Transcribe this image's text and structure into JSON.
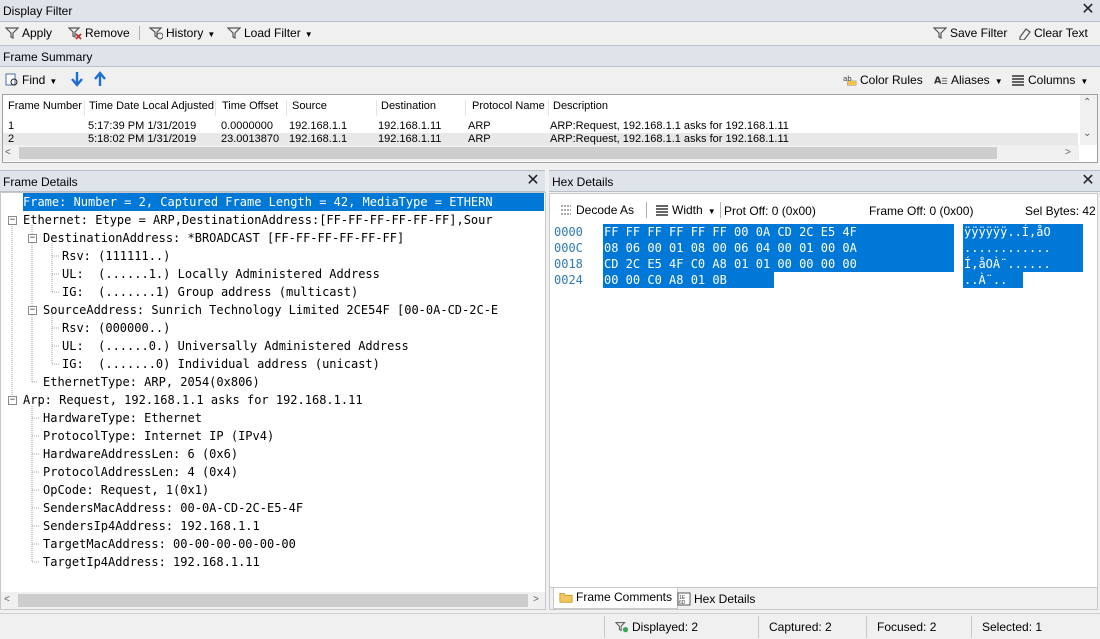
{
  "display_filter": {
    "title": "Display Filter",
    "apply": "Apply",
    "remove": "Remove",
    "history": "History",
    "load_filter": "Load Filter",
    "save_filter": "Save Filter",
    "clear_text": "Clear Text"
  },
  "frame_summary": {
    "title": "Frame Summary",
    "find": "Find",
    "color_rules": "Color Rules",
    "aliases": "Aliases",
    "columns": "Columns",
    "headers": [
      "Frame Number",
      "Time Date Local Adjusted",
      "Time Offset",
      "Source",
      "Destination",
      "Protocol Name",
      "Description"
    ],
    "rows": [
      [
        "1",
        "5:17:39 PM 1/31/2019",
        "0.0000000",
        "192.168.1.1",
        "192.168.1.11",
        "ARP",
        "ARP:Request, 192.168.1.1 asks for 192.168.1.11"
      ],
      [
        "2",
        "5:18:02 PM 1/31/2019",
        "23.0013870",
        "192.168.1.1",
        "192.168.1.11",
        "ARP",
        "ARP:Request, 192.168.1.1 asks for 192.168.1.11"
      ]
    ]
  },
  "frame_details": {
    "title": "Frame Details",
    "lines": [
      "Frame: Number = 2, Captured Frame Length = 42, MediaType = ETHERN",
      "Ethernet: Etype = ARP,DestinationAddress:[FF-FF-FF-FF-FF-FF],Sour",
      "DestinationAddress: *BROADCAST [FF-FF-FF-FF-FF-FF]",
      "Rsv: (111111..)",
      "UL:  (......1.) Locally Administered Address",
      "IG:  (.......1) Group address (multicast)",
      "SourceAddress: Sunrich Technology Limited 2CE54F [00-0A-CD-2C-E",
      "Rsv: (000000..)",
      "UL:  (......0.) Universally Administered Address",
      "IG:  (.......0) Individual address (unicast)",
      "EthernetType: ARP, 2054(0x806)",
      "Arp: Request, 192.168.1.1 asks for 192.168.1.11",
      "HardwareType: Ethernet",
      "ProtocolType: Internet IP (IPv4)",
      "HardwareAddressLen: 6 (0x6)",
      "ProtocolAddressLen: 4 (0x4)",
      "OpCode: Request, 1(0x1)",
      "SendersMacAddress: 00-0A-CD-2C-E5-4F",
      "SendersIp4Address: 192.168.1.1",
      "TargetMacAddress: 00-00-00-00-00-00",
      "TargetIp4Address: 192.168.1.11"
    ]
  },
  "hex_details": {
    "title": "Hex Details",
    "decode_as": "Decode As",
    "width": "Width",
    "prot_off": "Prot Off: 0 (0x00)",
    "frame_off": "Frame Off: 0 (0x00)",
    "sel_bytes": "Sel Bytes: 42",
    "offsets": [
      "0000",
      "000C",
      "0018",
      "0024"
    ],
    "hex_rows": [
      "FF FF FF FF FF FF 00 0A CD 2C E5 4F",
      "08 06 00 01 08 00 06 04 00 01 00 0A",
      "CD 2C E5 4F C0 A8 01 01 00 00 00 00",
      "00 00 C0 A8 01 0B"
    ],
    "ascii_rows": [
      "ÿÿÿÿÿÿ..Í,åO",
      "............",
      "Í,åOÀ¨......",
      "..À¨.."
    ],
    "tab_comments": "Frame Comments",
    "tab_hex": "Hex Details"
  },
  "status": {
    "displayed": "Displayed: 2",
    "captured": "Captured: 2",
    "focused": "Focused: 2",
    "selected": "Selected: 1"
  },
  "colors": {
    "accent": "#0078d7",
    "panel_header": "#dfe3ea"
  }
}
